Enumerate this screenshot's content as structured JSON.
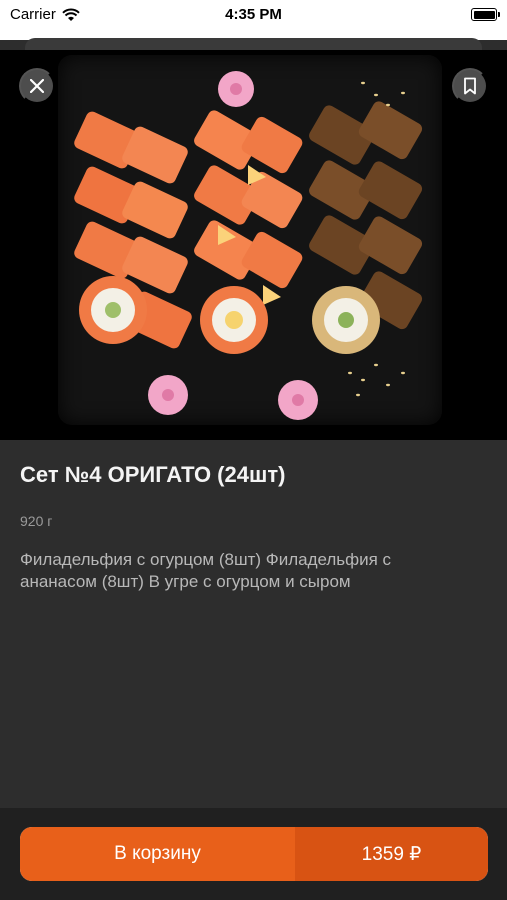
{
  "status_bar": {
    "carrier": "Carrier",
    "time": "4:35 PM",
    "battery_level": 1.0
  },
  "product": {
    "image_alt": "sushi set photo",
    "title": "Сет №4 ОРИГАТО (24шт)",
    "weight": "920 г",
    "description": "Филадельфия с огурцом (8шт) Филадельфия с ананасом (8шт) В угре с огурцом и сыром"
  },
  "actions": {
    "close_icon": "close-icon",
    "bookmark_icon": "bookmark-icon",
    "add_to_cart_label": "В корзину",
    "price": "1359 ₽"
  },
  "colors": {
    "accent": "#e8601a",
    "accent_dark": "#d85313",
    "background": "#2d2d2d",
    "bottom_bar": "#202020"
  }
}
